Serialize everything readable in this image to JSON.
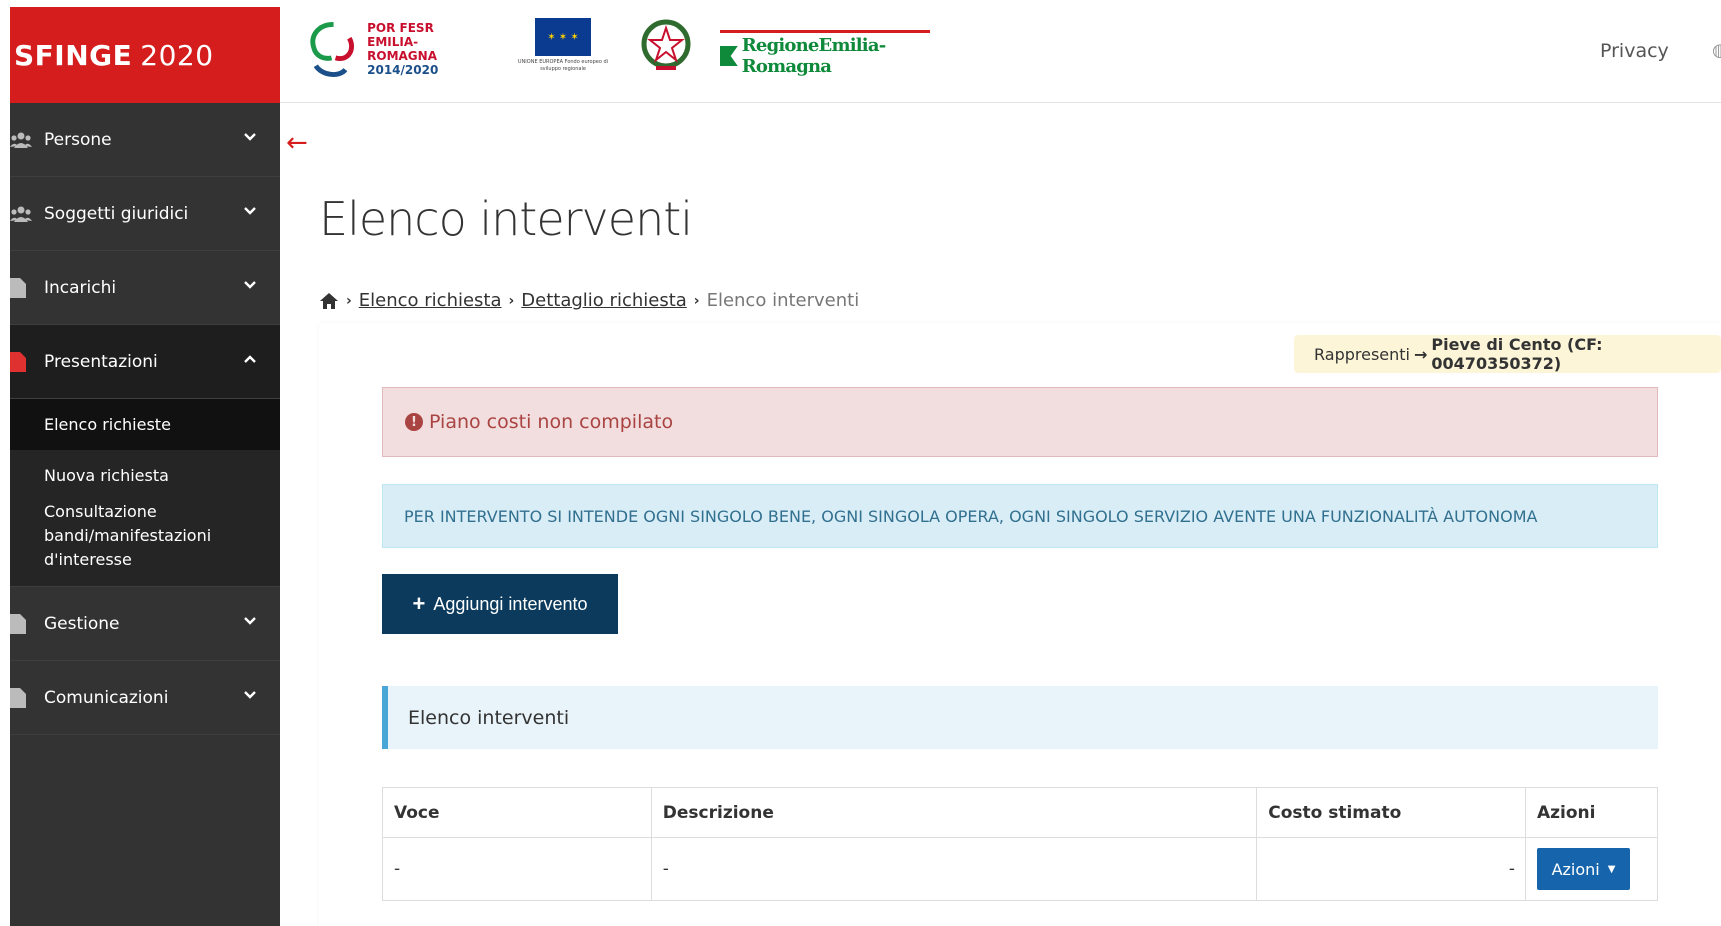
{
  "header": {
    "brand_name": "SFINGE",
    "brand_year": "2020",
    "logo_por_line1": "POR FESR",
    "logo_por_line2": "EMILIA-ROMAGNA",
    "logo_por_line3": "2014/2020",
    "logo_eu_caption": "UNIONE EUROPEA Fondo europeo di sviluppo regionale",
    "logo_region": "RegioneEmilia-Romagna",
    "privacy_link": "Privacy"
  },
  "sidebar": {
    "items": [
      {
        "label": "Persone",
        "icon": "users-icon"
      },
      {
        "label": "Soggetti giuridici",
        "icon": "users-icon"
      },
      {
        "label": "Incarichi",
        "icon": "file-icon"
      },
      {
        "label": "Presentazioni",
        "icon": "file-icon"
      },
      {
        "label": "Gestione",
        "icon": "file-icon"
      },
      {
        "label": "Comunicazioni",
        "icon": "file-icon"
      }
    ],
    "subitems": [
      {
        "label": "Elenco richieste"
      },
      {
        "label": "Nuova richiesta"
      },
      {
        "label": "Consultazione bandi/manifestazioni d'interesse"
      }
    ]
  },
  "page": {
    "title": "Elenco interventi",
    "breadcrumb": [
      "Elenco richiesta",
      "Dettaglio richiesta",
      "Elenco interventi"
    ],
    "rappresenti_label": "Rappresenti",
    "rappresenti_entity": "Pieve di Cento (CF: 00470350372)",
    "alert_danger": "Piano costi non compilato",
    "alert_info": "PER INTERVENTO SI INTENDE OGNI SINGOLO BENE, OGNI SINGOLA OPERA, OGNI SINGOLO SERVIZIO AVENTE UNA FUNZIONALITÀ AUTONOMA",
    "add_button": "Aggiungi intervento",
    "section_title": "Elenco interventi"
  },
  "table": {
    "headers": [
      "Voce",
      "Descrizione",
      "Costo stimato",
      "Azioni"
    ],
    "rows": [
      {
        "voce": "-",
        "descrizione": "-",
        "costo": "-",
        "azioni": "Azioni"
      }
    ]
  },
  "colors": {
    "brand_red": "#d51d1d",
    "sidebar_bg": "#333333",
    "button_dark_blue": "#0b3a5c",
    "button_blue": "#1665ac"
  }
}
